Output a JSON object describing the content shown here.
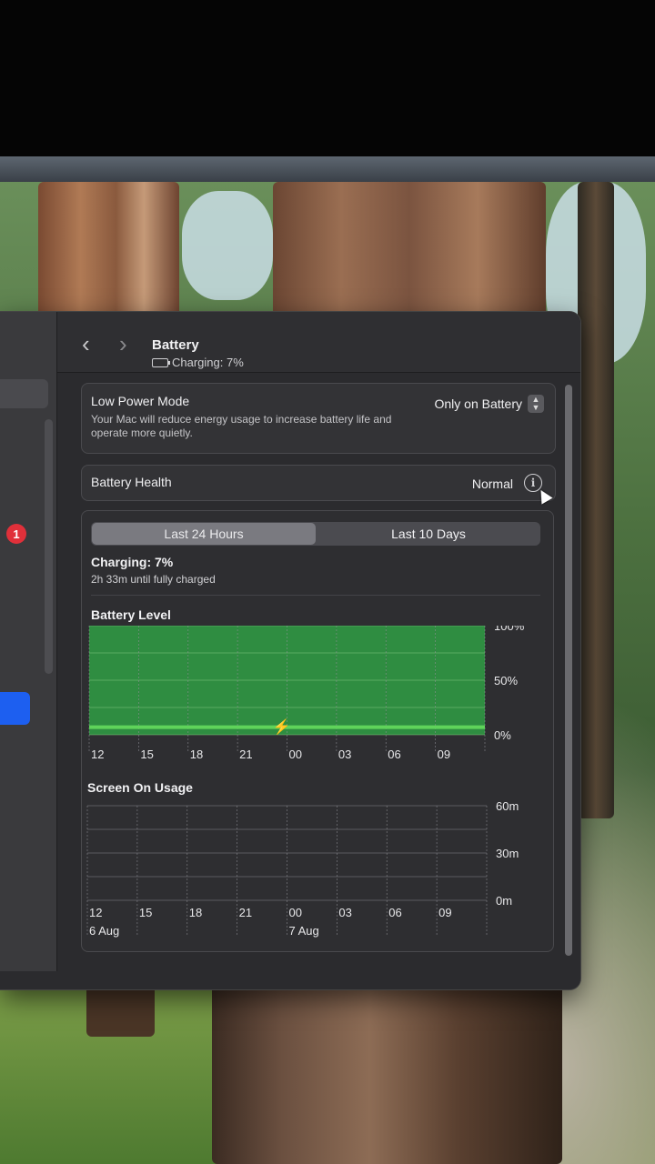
{
  "window": {
    "title": "Battery",
    "subtitle": "Charging: 7%",
    "nav_back": "‹",
    "nav_forward": "›"
  },
  "sidebar": {
    "badge_count": "1"
  },
  "low_power_mode": {
    "label": "Low Power Mode",
    "description": "Your Mac will reduce energy usage to increase battery life and operate more quietly.",
    "value": "Only on Battery"
  },
  "battery_health": {
    "label": "Battery Health",
    "value": "Normal"
  },
  "usage": {
    "tabs": [
      "Last 24 Hours",
      "Last 10 Days"
    ],
    "selected_tab": 0,
    "status_title": "Charging: 7%",
    "status_detail": "2h 33m until fully charged"
  },
  "chart_data": [
    {
      "type": "area",
      "title": "Battery Level",
      "x": [
        "12",
        "15",
        "18",
        "21",
        "00",
        "03",
        "06",
        "09"
      ],
      "y_ticks": [
        "100%",
        "50%",
        "0%"
      ],
      "ylim": [
        0,
        100
      ],
      "values": [
        100,
        100,
        100,
        100,
        100,
        100,
        100,
        100
      ],
      "current_level_percent": 7,
      "charging_marker_at": "00",
      "fill_color": "#2f9e44",
      "line_color": "#5fd35a"
    },
    {
      "type": "bar",
      "title": "Screen On Usage",
      "x": [
        "12",
        "15",
        "18",
        "21",
        "00",
        "03",
        "06",
        "09"
      ],
      "date_labels": [
        {
          "at": "12",
          "text": "6 Aug"
        },
        {
          "at": "00",
          "text": "7 Aug"
        }
      ],
      "y_ticks": [
        "60m",
        "30m",
        "0m"
      ],
      "ylim": [
        0,
        60
      ],
      "values": [
        0,
        0,
        0,
        0,
        0,
        0,
        0,
        0
      ]
    }
  ]
}
